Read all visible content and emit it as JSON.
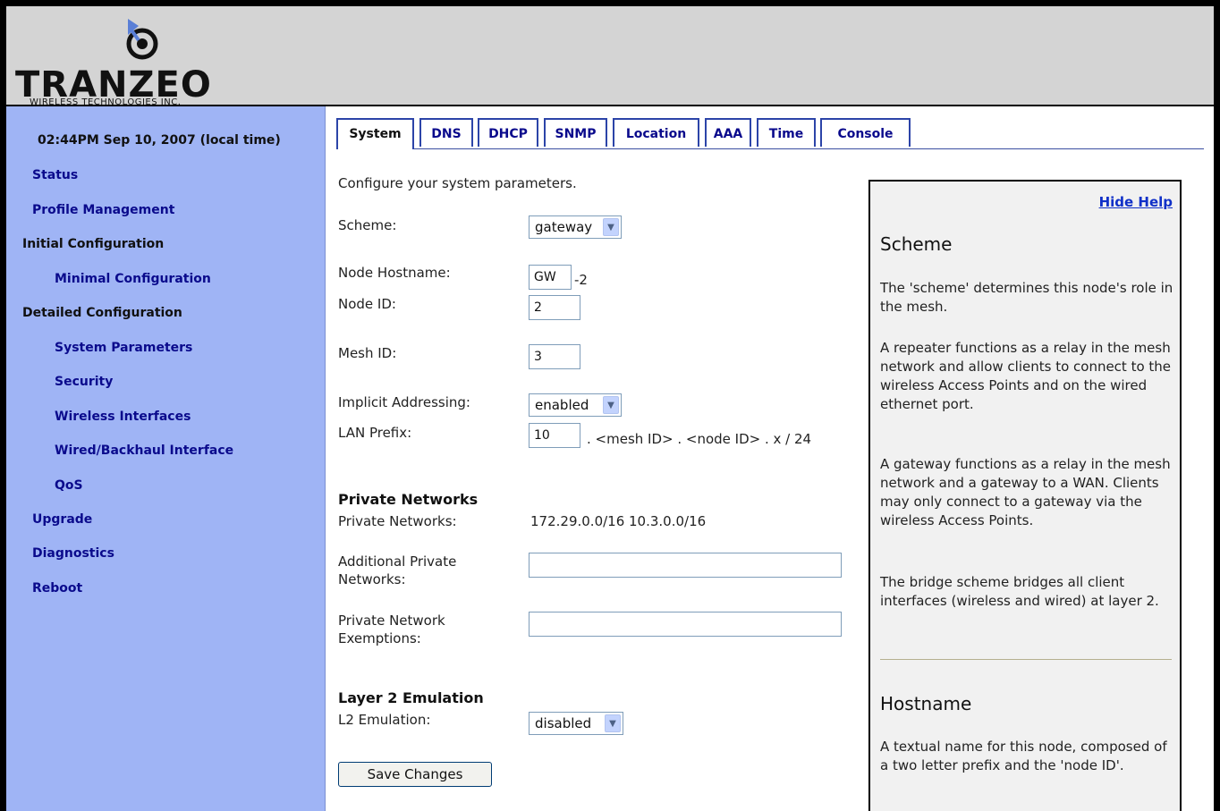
{
  "brand": {
    "wordmark": "TRANZEO",
    "subtitle": "WIRELESS TECHNOLOGIES INC."
  },
  "sidebar": {
    "clock": "02:44PM Sep 10, 2007 (local time)",
    "items": [
      {
        "label": "Status"
      },
      {
        "label": "Profile Management"
      },
      {
        "label": "Initial Configuration"
      },
      {
        "label": "Minimal Configuration"
      },
      {
        "label": "Detailed Configuration"
      },
      {
        "label": "System Parameters"
      },
      {
        "label": "Security"
      },
      {
        "label": "Wireless Interfaces"
      },
      {
        "label": "Wired/Backhaul Interface"
      },
      {
        "label": "QoS"
      },
      {
        "label": "Upgrade"
      },
      {
        "label": "Diagnostics"
      },
      {
        "label": "Reboot"
      }
    ]
  },
  "tabs": [
    "System",
    "DNS",
    "DHCP",
    "SNMP",
    "Location",
    "AAA",
    "Time",
    "Console"
  ],
  "form": {
    "intro": "Configure your system parameters.",
    "scheme_label": "Scheme:",
    "scheme_value": "gateway",
    "hostname_label": "Node Hostname:",
    "hostname_value": "GW",
    "hostname_suffix": "-2",
    "nodeid_label": "Node ID:",
    "nodeid_value": "2",
    "meshid_label": "Mesh ID:",
    "meshid_value": "3",
    "implicit_label": "Implicit Addressing:",
    "implicit_value": "enabled",
    "lan_label": "LAN Prefix:",
    "lan_value": "10",
    "lan_suffix": ". <mesh ID> . <node ID> . x / 24",
    "private_heading": "Private Networks",
    "private_label": "Private Networks:",
    "private_value": "172.29.0.0/16 10.3.0.0/16",
    "addl_label_1": "Additional Private",
    "addl_label_2": "Networks:",
    "addl_value": "",
    "exempt_label_1": "Private Network",
    "exempt_label_2": "Exemptions:",
    "exempt_value": "",
    "l2_heading": "Layer 2 Emulation",
    "l2_label": "L2 Emulation:",
    "l2_value": "disabled",
    "save_label": "Save Changes"
  },
  "help": {
    "hide_label": "Hide Help",
    "scheme_title": "Scheme",
    "scheme_p1": "The 'scheme' determines this node's role in the mesh.",
    "scheme_p2": "A repeater functions as a relay in the mesh network and allow clients to connect to the wireless Access Points and on the wired ethernet port.",
    "scheme_p3": "A gateway functions as a relay in the mesh network and a gateway to a WAN. Clients may only connect to a gateway via the wireless Access Points.",
    "scheme_p4": "The bridge scheme bridges all client interfaces (wireless and wired) at layer 2.",
    "hostname_title": "Hostname",
    "hostname_p1": "A textual name for this node, composed of a two letter prefix and the 'node ID'."
  },
  "colors": {
    "sidebar_bg": "#9fb4f5",
    "header_bg": "#d4d4d4",
    "link": "#0a0a8c",
    "tab_border": "#2c44a8"
  }
}
